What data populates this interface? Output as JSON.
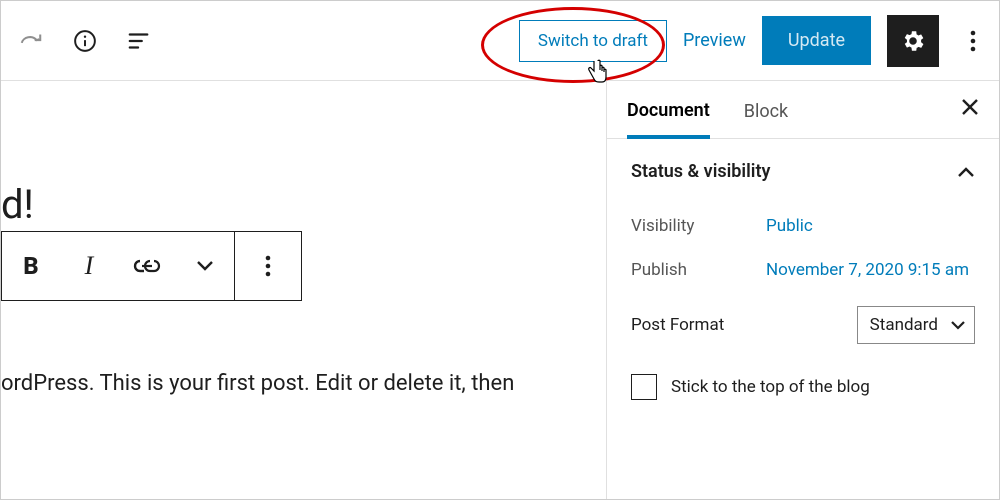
{
  "toolbar": {
    "switch_draft": "Switch to draft",
    "preview": "Preview",
    "update": "Update"
  },
  "editor": {
    "title_fragment": "d!",
    "body_fragment": "ordPress. This is your first post. Edit or delete it, then"
  },
  "sidebar": {
    "tabs": {
      "document": "Document",
      "block": "Block"
    },
    "status_panel": {
      "title": "Status & visibility",
      "visibility_label": "Visibility",
      "visibility_value": "Public",
      "publish_label": "Publish",
      "publish_value": "November 7, 2020 9:15 am",
      "post_format_label": "Post Format",
      "post_format_value": "Standard",
      "stick_label": "Stick to the top of the blog"
    }
  }
}
